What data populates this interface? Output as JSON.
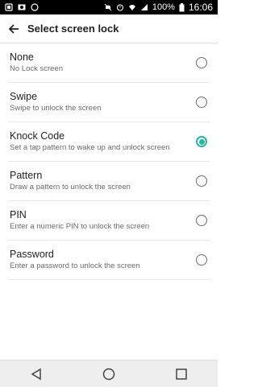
{
  "status_bar": {
    "battery_percent": "100%",
    "time": "16:06",
    "left_icons": [
      "notification-icon",
      "photo-icon",
      "chat-icon"
    ],
    "right_icons": [
      "mute-icon",
      "alarm-icon",
      "wifi-icon",
      "signal-icon",
      "battery-icon"
    ]
  },
  "header": {
    "title": "Select screen lock",
    "back_icon": "arrow-left-icon"
  },
  "options": [
    {
      "title": "None",
      "subtitle": "No Lock screen",
      "selected": false
    },
    {
      "title": "Swipe",
      "subtitle": "Swipe to unlock the screen",
      "selected": false
    },
    {
      "title": "Knock Code",
      "subtitle": "Set a tap pattern to wake up and unlock screen",
      "selected": true
    },
    {
      "title": "Pattern",
      "subtitle": "Draw a pattern to unlock the screen",
      "selected": false
    },
    {
      "title": "PIN",
      "subtitle": "Enter a numeric PIN to unlock the screen",
      "selected": false
    },
    {
      "title": "Password",
      "subtitle": "Enter a password to unlock the screen",
      "selected": false
    }
  ],
  "colors": {
    "accent": "#27b7a1",
    "status_bar_bg": "#000000",
    "nav_bar_bg": "#eeeeee"
  },
  "nav_bar": {
    "buttons": [
      "back-triangle-icon",
      "home-circle-icon",
      "recents-square-icon"
    ]
  }
}
